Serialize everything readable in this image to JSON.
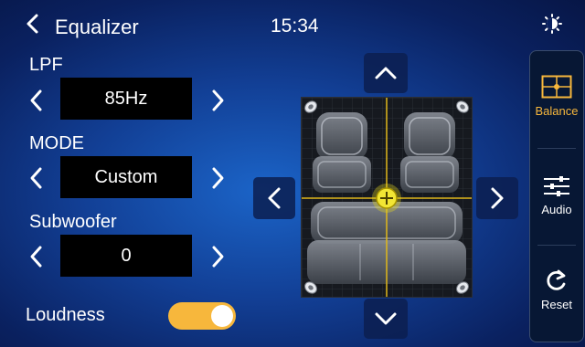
{
  "header": {
    "title": "Equalizer",
    "time": "15:34"
  },
  "lpf": {
    "label": "LPF",
    "value": "85Hz"
  },
  "mode": {
    "label": "MODE",
    "value": "Custom"
  },
  "subwoofer": {
    "label": "Subwoofer",
    "value": "0"
  },
  "loudness": {
    "label": "Loudness",
    "state": "on"
  },
  "side": {
    "balance": "Balance",
    "audio": "Audio",
    "reset": "Reset"
  },
  "colors": {
    "accent": "#f7b73c",
    "crosshair": "#e0b81b",
    "panel": "#071734"
  }
}
